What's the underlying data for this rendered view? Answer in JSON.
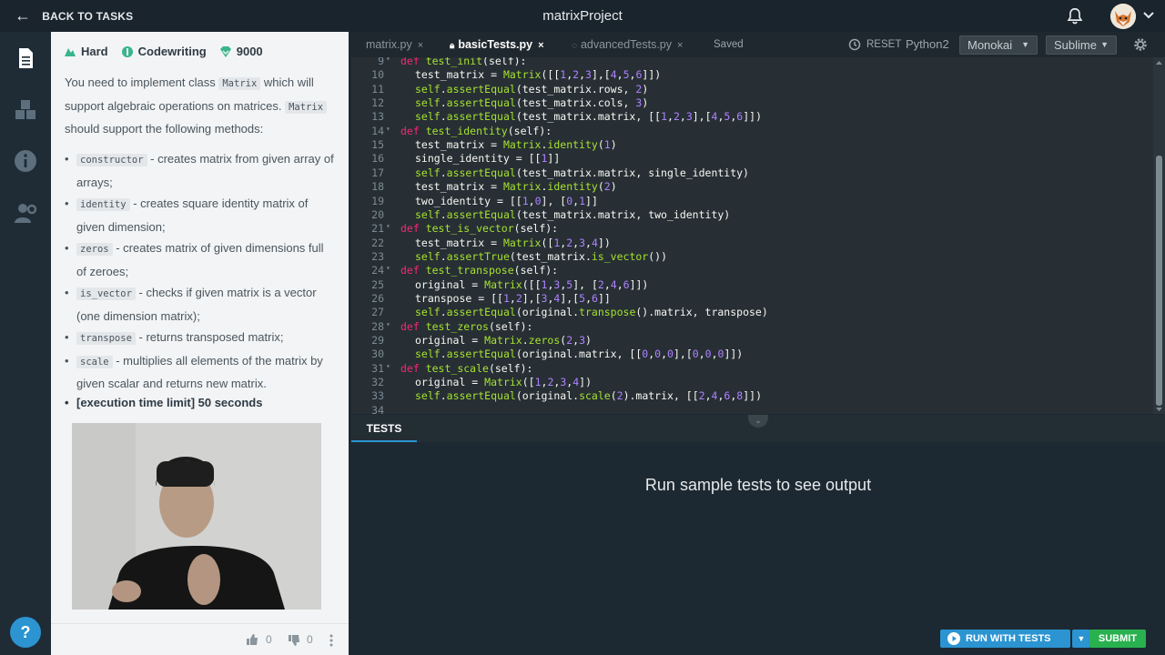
{
  "topbar": {
    "back_label": "BACK TO TASKS",
    "title": "matrixProject"
  },
  "task": {
    "difficulty": "Hard",
    "type": "Codewriting",
    "points": "9000",
    "intro_1": "You need to implement class",
    "intro_code": "Matrix",
    "intro_2": "which will support algebraic operations on matrices.",
    "intro_code_2": "Matrix",
    "intro_3": "should support the following methods:",
    "methods": [
      {
        "code": "constructor",
        "text": " - creates matrix from given array of arrays;"
      },
      {
        "code": "identity",
        "text": " - creates square identity matrix of given dimension;"
      },
      {
        "code": "zeros",
        "text": " - creates matrix of given dimensions full of zeroes;"
      },
      {
        "code": "is_vector",
        "text": " - checks if given matrix is a vector (one dimension matrix);"
      },
      {
        "code": "transpose",
        "text": " - returns transposed matrix;"
      },
      {
        "code": "scale",
        "text": " - multiplies all elements of the matrix by given scalar and returns new matrix."
      }
    ],
    "limit": "[execution time limit] 50 seconds",
    "likes": "0",
    "dislikes": "0"
  },
  "editor": {
    "tabs": [
      {
        "label": "matrix.py",
        "active": false
      },
      {
        "label": "basicTests.py",
        "active": true
      },
      {
        "label": "advancedTests.py",
        "active": false
      }
    ],
    "saved": "Saved",
    "reset": "RESET",
    "language": "Python2",
    "theme": "Monokai",
    "keymap": "Sublime",
    "lines": [
      {
        "n": "9",
        "fold": true,
        "indent": 1,
        "tokens": [
          [
            "kw",
            "def "
          ],
          [
            "fn",
            "test_init"
          ],
          [
            "pl",
            "(self):"
          ]
        ]
      },
      {
        "n": "10",
        "indent": 2,
        "tokens": [
          [
            "pl",
            "test_matrix = "
          ],
          [
            "fn",
            "Matrix"
          ],
          [
            "pl",
            "([["
          ],
          [
            "nm",
            "1"
          ],
          [
            "pl",
            ","
          ],
          [
            "nm",
            "2"
          ],
          [
            "pl",
            ","
          ],
          [
            "nm",
            "3"
          ],
          [
            "pl",
            "],["
          ],
          [
            "nm",
            "4"
          ],
          [
            "pl",
            ","
          ],
          [
            "nm",
            "5"
          ],
          [
            "pl",
            ","
          ],
          [
            "nm",
            "6"
          ],
          [
            "pl",
            "]])"
          ]
        ]
      },
      {
        "n": "11",
        "indent": 2,
        "tokens": [
          [
            "self",
            "self"
          ],
          [
            "pl",
            "."
          ],
          [
            "fn",
            "assertEqual"
          ],
          [
            "pl",
            "(test_matrix.rows, "
          ],
          [
            "nm",
            "2"
          ],
          [
            "pl",
            ")"
          ]
        ]
      },
      {
        "n": "12",
        "indent": 2,
        "tokens": [
          [
            "self",
            "self"
          ],
          [
            "pl",
            "."
          ],
          [
            "fn",
            "assertEqual"
          ],
          [
            "pl",
            "(test_matrix.cols, "
          ],
          [
            "nm",
            "3"
          ],
          [
            "pl",
            ")"
          ]
        ]
      },
      {
        "n": "13",
        "indent": 2,
        "tokens": [
          [
            "self",
            "self"
          ],
          [
            "pl",
            "."
          ],
          [
            "fn",
            "assertEqual"
          ],
          [
            "pl",
            "(test_matrix.matrix, [["
          ],
          [
            "nm",
            "1"
          ],
          [
            "pl",
            ","
          ],
          [
            "nm",
            "2"
          ],
          [
            "pl",
            ","
          ],
          [
            "nm",
            "3"
          ],
          [
            "pl",
            "],["
          ],
          [
            "nm",
            "4"
          ],
          [
            "pl",
            ","
          ],
          [
            "nm",
            "5"
          ],
          [
            "pl",
            ","
          ],
          [
            "nm",
            "6"
          ],
          [
            "pl",
            "]])"
          ]
        ]
      },
      {
        "n": "14",
        "fold": true,
        "indent": 1,
        "tokens": [
          [
            "kw",
            "def "
          ],
          [
            "fn",
            "test_identity"
          ],
          [
            "pl",
            "(self):"
          ]
        ]
      },
      {
        "n": "15",
        "indent": 2,
        "tokens": [
          [
            "pl",
            "test_matrix = "
          ],
          [
            "fn",
            "Matrix"
          ],
          [
            "pl",
            "."
          ],
          [
            "fn",
            "identity"
          ],
          [
            "pl",
            "("
          ],
          [
            "nm",
            "1"
          ],
          [
            "pl",
            ")"
          ]
        ]
      },
      {
        "n": "16",
        "indent": 2,
        "tokens": [
          [
            "pl",
            "single_identity = [["
          ],
          [
            "nm",
            "1"
          ],
          [
            "pl",
            "]]"
          ]
        ]
      },
      {
        "n": "17",
        "indent": 2,
        "tokens": [
          [
            "self",
            "self"
          ],
          [
            "pl",
            "."
          ],
          [
            "fn",
            "assertEqual"
          ],
          [
            "pl",
            "(test_matrix.matrix, single_identity)"
          ]
        ]
      },
      {
        "n": "18",
        "indent": 2,
        "tokens": [
          [
            "pl",
            "test_matrix = "
          ],
          [
            "fn",
            "Matrix"
          ],
          [
            "pl",
            "."
          ],
          [
            "fn",
            "identity"
          ],
          [
            "pl",
            "("
          ],
          [
            "nm",
            "2"
          ],
          [
            "pl",
            ")"
          ]
        ]
      },
      {
        "n": "19",
        "indent": 2,
        "tokens": [
          [
            "pl",
            "two_identity = [["
          ],
          [
            "nm",
            "1"
          ],
          [
            "pl",
            ","
          ],
          [
            "nm",
            "0"
          ],
          [
            "pl",
            "], ["
          ],
          [
            "nm",
            "0"
          ],
          [
            "pl",
            ","
          ],
          [
            "nm",
            "1"
          ],
          [
            "pl",
            "]]"
          ]
        ]
      },
      {
        "n": "20",
        "indent": 2,
        "tokens": [
          [
            "self",
            "self"
          ],
          [
            "pl",
            "."
          ],
          [
            "fn",
            "assertEqual"
          ],
          [
            "pl",
            "(test_matrix.matrix, two_identity)"
          ]
        ]
      },
      {
        "n": "21",
        "fold": true,
        "indent": 1,
        "tokens": [
          [
            "kw",
            "def "
          ],
          [
            "fn",
            "test_is_vector"
          ],
          [
            "pl",
            "(self):"
          ]
        ]
      },
      {
        "n": "22",
        "indent": 2,
        "tokens": [
          [
            "pl",
            "test_matrix = "
          ],
          [
            "fn",
            "Matrix"
          ],
          [
            "pl",
            "(["
          ],
          [
            "nm",
            "1"
          ],
          [
            "pl",
            ","
          ],
          [
            "nm",
            "2"
          ],
          [
            "pl",
            ","
          ],
          [
            "nm",
            "3"
          ],
          [
            "pl",
            ","
          ],
          [
            "nm",
            "4"
          ],
          [
            "pl",
            "])"
          ]
        ]
      },
      {
        "n": "23",
        "indent": 2,
        "tokens": [
          [
            "self",
            "self"
          ],
          [
            "pl",
            "."
          ],
          [
            "fn",
            "assertTrue"
          ],
          [
            "pl",
            "(test_matrix."
          ],
          [
            "fn",
            "is_vector"
          ],
          [
            "pl",
            "())"
          ]
        ]
      },
      {
        "n": "24",
        "fold": true,
        "indent": 1,
        "tokens": [
          [
            "kw",
            "def "
          ],
          [
            "fn",
            "test_transpose"
          ],
          [
            "pl",
            "(self):"
          ]
        ]
      },
      {
        "n": "25",
        "indent": 2,
        "tokens": [
          [
            "pl",
            "original = "
          ],
          [
            "fn",
            "Matrix"
          ],
          [
            "pl",
            "([["
          ],
          [
            "nm",
            "1"
          ],
          [
            "pl",
            ","
          ],
          [
            "nm",
            "3"
          ],
          [
            "pl",
            ","
          ],
          [
            "nm",
            "5"
          ],
          [
            "pl",
            "], ["
          ],
          [
            "nm",
            "2"
          ],
          [
            "pl",
            ","
          ],
          [
            "nm",
            "4"
          ],
          [
            "pl",
            ","
          ],
          [
            "nm",
            "6"
          ],
          [
            "pl",
            "]])"
          ]
        ]
      },
      {
        "n": "26",
        "indent": 2,
        "tokens": [
          [
            "pl",
            "transpose = [["
          ],
          [
            "nm",
            "1"
          ],
          [
            "pl",
            ","
          ],
          [
            "nm",
            "2"
          ],
          [
            "pl",
            "],["
          ],
          [
            "nm",
            "3"
          ],
          [
            "pl",
            ","
          ],
          [
            "nm",
            "4"
          ],
          [
            "pl",
            "],["
          ],
          [
            "nm",
            "5"
          ],
          [
            "pl",
            ","
          ],
          [
            "nm",
            "6"
          ],
          [
            "pl",
            "]]"
          ]
        ]
      },
      {
        "n": "27",
        "indent": 2,
        "tokens": [
          [
            "self",
            "self"
          ],
          [
            "pl",
            "."
          ],
          [
            "fn",
            "assertEqual"
          ],
          [
            "pl",
            "(original."
          ],
          [
            "fn",
            "transpose"
          ],
          [
            "pl",
            "().matrix, transpose)"
          ]
        ]
      },
      {
        "n": "28",
        "fold": true,
        "indent": 1,
        "tokens": [
          [
            "kw",
            "def "
          ],
          [
            "fn",
            "test_zeros"
          ],
          [
            "pl",
            "(self):"
          ]
        ]
      },
      {
        "n": "29",
        "indent": 2,
        "tokens": [
          [
            "pl",
            "original = "
          ],
          [
            "fn",
            "Matrix"
          ],
          [
            "pl",
            "."
          ],
          [
            "fn",
            "zeros"
          ],
          [
            "pl",
            "("
          ],
          [
            "nm",
            "2"
          ],
          [
            "pl",
            ","
          ],
          [
            "nm",
            "3"
          ],
          [
            "pl",
            ")"
          ]
        ]
      },
      {
        "n": "30",
        "indent": 2,
        "tokens": [
          [
            "self",
            "self"
          ],
          [
            "pl",
            "."
          ],
          [
            "fn",
            "assertEqual"
          ],
          [
            "pl",
            "(original.matrix, [["
          ],
          [
            "nm",
            "0"
          ],
          [
            "pl",
            ","
          ],
          [
            "nm",
            "0"
          ],
          [
            "pl",
            ","
          ],
          [
            "nm",
            "0"
          ],
          [
            "pl",
            "],["
          ],
          [
            "nm",
            "0"
          ],
          [
            "pl",
            ","
          ],
          [
            "nm",
            "0"
          ],
          [
            "pl",
            ","
          ],
          [
            "nm",
            "0"
          ],
          [
            "pl",
            "]])"
          ]
        ]
      },
      {
        "n": "31",
        "fold": true,
        "indent": 1,
        "tokens": [
          [
            "kw",
            "def "
          ],
          [
            "fn",
            "test_scale"
          ],
          [
            "pl",
            "(self):"
          ]
        ]
      },
      {
        "n": "32",
        "indent": 2,
        "tokens": [
          [
            "pl",
            "original = "
          ],
          [
            "fn",
            "Matrix"
          ],
          [
            "pl",
            "(["
          ],
          [
            "nm",
            "1"
          ],
          [
            "pl",
            ","
          ],
          [
            "nm",
            "2"
          ],
          [
            "pl",
            ","
          ],
          [
            "nm",
            "3"
          ],
          [
            "pl",
            ","
          ],
          [
            "nm",
            "4"
          ],
          [
            "pl",
            "])"
          ]
        ]
      },
      {
        "n": "33",
        "indent": 2,
        "tokens": [
          [
            "self",
            "self"
          ],
          [
            "pl",
            "."
          ],
          [
            "fn",
            "assertEqual"
          ],
          [
            "pl",
            "(original."
          ],
          [
            "fn",
            "scale"
          ],
          [
            "pl",
            "("
          ],
          [
            "nm",
            "2"
          ],
          [
            "pl",
            ").matrix, [["
          ],
          [
            "nm",
            "2"
          ],
          [
            "pl",
            ","
          ],
          [
            "nm",
            "4"
          ],
          [
            "pl",
            ","
          ],
          [
            "nm",
            "6"
          ],
          [
            "pl",
            ","
          ],
          [
            "nm",
            "8"
          ],
          [
            "pl",
            "]])"
          ]
        ]
      },
      {
        "n": "34",
        "indent": 0,
        "tokens": []
      }
    ]
  },
  "tests": {
    "tab_label": "TESTS",
    "empty_message": "Run sample tests to see output"
  },
  "actions": {
    "run_label": "RUN WITH TESTS",
    "submit_label": "SUBMIT"
  },
  "colors": {
    "accent": "#2b94d1",
    "submit": "#29b14f",
    "keyword": "#f92672",
    "function": "#a6e22e",
    "number": "#ae81ff"
  }
}
